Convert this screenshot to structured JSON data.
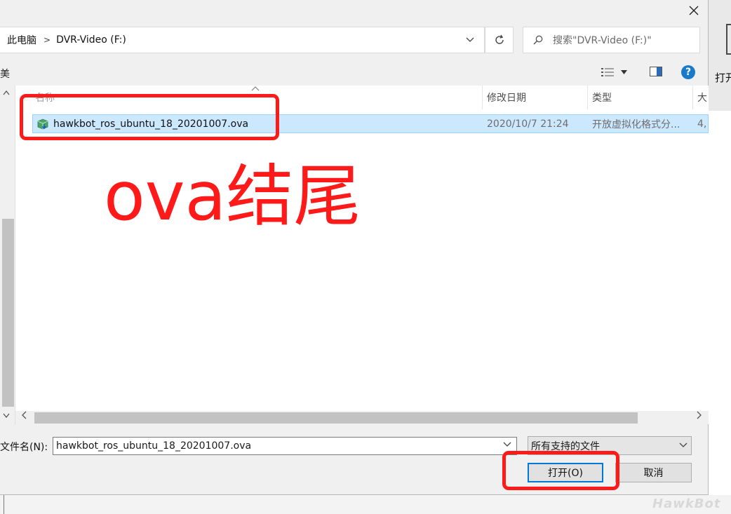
{
  "background_window": {
    "label": "打开"
  },
  "dialog": {
    "address": {
      "breadcrumb": [
        "此电脑",
        "DVR-Video (F:)"
      ]
    },
    "search": {
      "placeholder": "搜索\"DVR-Video (F:)\""
    },
    "toolbar": {
      "clipped_label": "美"
    },
    "help_label": "?",
    "columns": {
      "name": "名称",
      "date": "修改日期",
      "type": "类型",
      "size": "大"
    },
    "files": [
      {
        "name": "hawkbot_ros_ubuntu_18_20201007.ova",
        "date": "2020/10/7 21:24",
        "type": "开放虚拟化格式分...",
        "size": "4,"
      }
    ],
    "filename": {
      "label": "文件名(N):",
      "value": "hawkbot_ros_ubuntu_18_20201007.ova"
    },
    "filetype": {
      "selected": "所有支持的文件"
    },
    "buttons": {
      "open": "打开(O)",
      "cancel": "取消"
    }
  },
  "annotation": {
    "text": "ova结尾",
    "color": "#ff1a1a"
  },
  "watermark": {
    "text": "HawkBot"
  },
  "colors": {
    "selection_bg": "#cce8ff",
    "selection_border": "#99d1ff",
    "accent": "#0078d7"
  }
}
